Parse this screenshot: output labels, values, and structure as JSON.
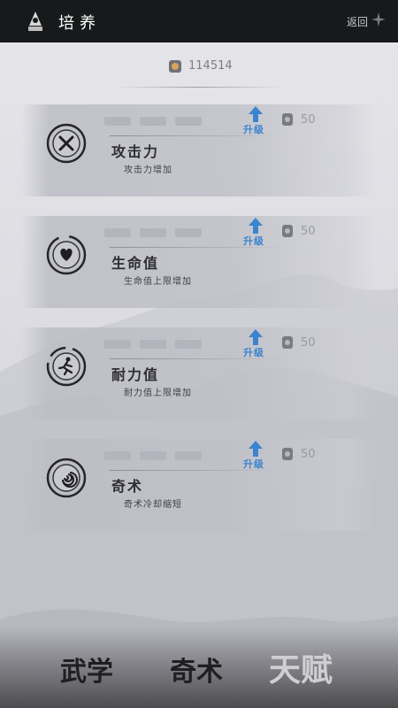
{
  "header": {
    "title": "培养",
    "back_label": "返回"
  },
  "currency": {
    "value": "114514"
  },
  "skills": [
    {
      "name": "攻击力",
      "desc": "攻击力增加",
      "upgrade_label": "升级",
      "cost": "50",
      "icon": "crossed-swords-icon"
    },
    {
      "name": "生命值",
      "desc": "生命值上限增加",
      "upgrade_label": "升级",
      "cost": "50",
      "icon": "heart-icon"
    },
    {
      "name": "耐力值",
      "desc": "耐力值上限增加",
      "upgrade_label": "升级",
      "cost": "50",
      "icon": "runner-icon"
    },
    {
      "name": "奇术",
      "desc": "奇术冷却缩短",
      "upgrade_label": "升级",
      "cost": "50",
      "icon": "swirl-icon"
    }
  ],
  "tabs": [
    {
      "label": "武学",
      "active": false
    },
    {
      "label": "奇术",
      "active": false
    },
    {
      "label": "天赋",
      "active": true
    }
  ],
  "colors": {
    "upgrade": "#3b84cf",
    "topbar": "#17191b"
  }
}
